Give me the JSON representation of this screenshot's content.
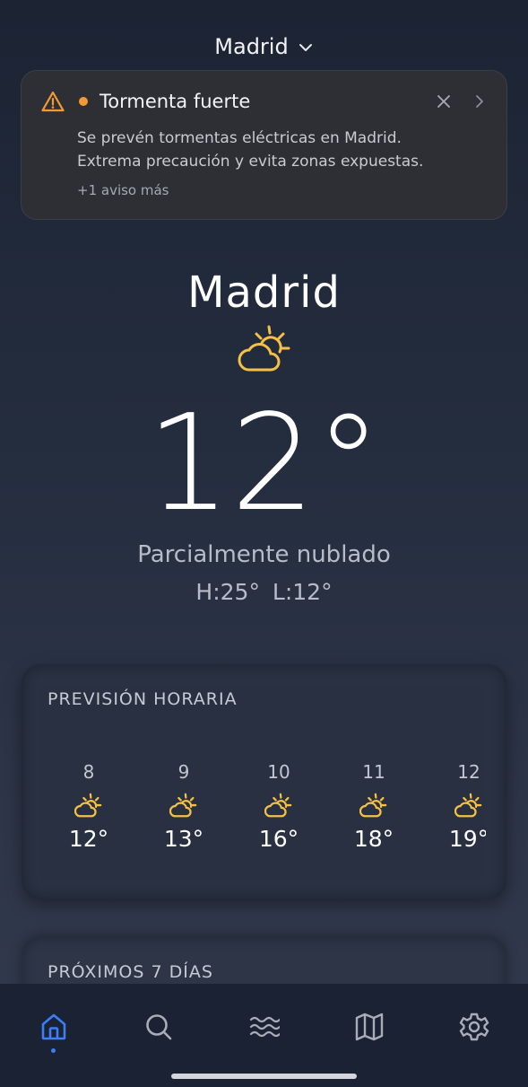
{
  "header": {
    "location": "Madrid"
  },
  "alert": {
    "title": "Tormenta fuerte",
    "message_line1": "Se prevén tormentas eléctricas en Madrid.",
    "message_line2": "Extrema precaución y evita zonas expuestas.",
    "more": "+1 aviso más",
    "accent_color": "#f39a35"
  },
  "current": {
    "city": "Madrid",
    "icon": "partly-cloudy-day-icon",
    "temperature": "12°",
    "condition": "Parcialmente nublado",
    "hi_lo": "H:25°  L:12°"
  },
  "hourly": {
    "title": "PREVISIÓN HORARIA",
    "items": [
      {
        "hour": "8",
        "temp": "12°",
        "icon": "partly-cloudy-day-icon"
      },
      {
        "hour": "9",
        "temp": "13°",
        "icon": "partly-cloudy-day-icon"
      },
      {
        "hour": "10",
        "temp": "16°",
        "icon": "partly-cloudy-day-icon"
      },
      {
        "hour": "11",
        "temp": "18°",
        "icon": "partly-cloudy-day-icon"
      },
      {
        "hour": "12",
        "temp": "19°",
        "icon": "partly-cloudy-day-icon"
      }
    ]
  },
  "daily": {
    "title": "PRÓXIMOS 7 DÍAS"
  },
  "nav": {
    "items": [
      "home-icon",
      "search-icon",
      "waves-icon",
      "map-icon",
      "settings-icon"
    ],
    "active_color": "#3b7ef6"
  },
  "colors": {
    "icon_yellow": "#f5c046"
  }
}
